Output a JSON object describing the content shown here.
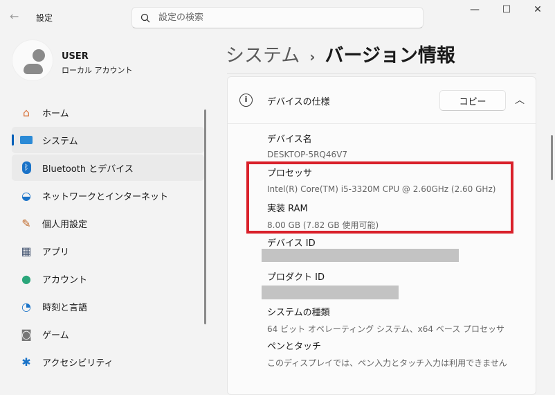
{
  "app": {
    "title": "設定",
    "back": "←"
  },
  "search": {
    "placeholder": "設定の検索"
  },
  "window_controls": {
    "minimize": "—",
    "maximize": "☐",
    "close": "✕"
  },
  "user": {
    "name": "USER",
    "account_type": "ローカル アカウント"
  },
  "nav": [
    {
      "label": "ホーム",
      "icon": "home-icon"
    },
    {
      "label": "システム",
      "icon": "system-icon",
      "selected": true
    },
    {
      "label": "Bluetooth とデバイス",
      "icon": "bluetooth-icon"
    },
    {
      "label": "ネットワークとインターネット",
      "icon": "wifi-icon"
    },
    {
      "label": "個人用設定",
      "icon": "brush-icon"
    },
    {
      "label": "アプリ",
      "icon": "apps-icon"
    },
    {
      "label": "アカウント",
      "icon": "account-icon"
    },
    {
      "label": "時刻と言語",
      "icon": "time-language-icon"
    },
    {
      "label": "ゲーム",
      "icon": "game-icon"
    },
    {
      "label": "アクセシビリティ",
      "icon": "accessibility-icon"
    }
  ],
  "breadcrumb": {
    "parent": "システム",
    "separator": "›",
    "current": "バージョン情報"
  },
  "card": {
    "title": "デバイスの仕様",
    "copy_label": "コピー",
    "specs": [
      {
        "label": "デバイス名",
        "value": "DESKTOP-5RQ46V7"
      },
      {
        "label": "プロセッサ",
        "value": "Intel(R) Core(TM) i5-3320M CPU @ 2.60GHz (2.60 GHz)"
      },
      {
        "label": "実装 RAM",
        "value": "8.00 GB (7.82 GB 使用可能)"
      },
      {
        "label": "デバイス ID",
        "value": ""
      },
      {
        "label": "プロダクト ID",
        "value": ""
      },
      {
        "label": "システムの種類",
        "value": "64 ビット オペレーティング システム、x64 ベース プロセッサ"
      },
      {
        "label": "ペンとタッチ",
        "value": "このディスプレイでは、ペン入力とタッチ入力は利用できません"
      }
    ]
  },
  "colors": {
    "accent": "#005fb8",
    "highlight_box": "#d9202a"
  }
}
